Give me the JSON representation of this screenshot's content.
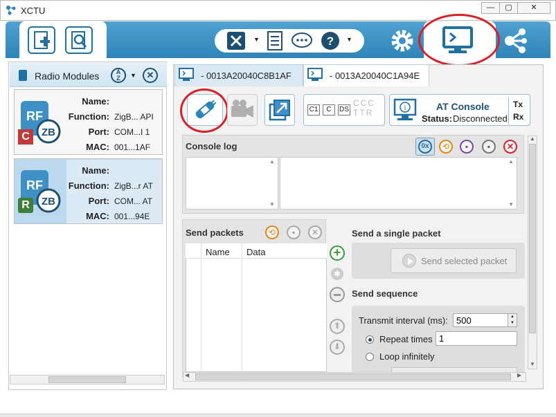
{
  "window": {
    "title": "XCTU"
  },
  "left_panel": {
    "title": "Radio Modules"
  },
  "modules": [
    {
      "badge": "C",
      "badge_color": "#c0393b",
      "name": "",
      "function": "ZigB... API",
      "port": "COM...I 1",
      "mac": "001...1AF"
    },
    {
      "badge": "R",
      "badge_color": "#3e7d3a",
      "name": "",
      "function": "ZigB...r AT",
      "port": "COM... AT",
      "mac": "001...94E"
    }
  ],
  "field_labels": {
    "name": "Name:",
    "function": "Function:",
    "port": "Port:",
    "mac": "MAC:"
  },
  "tabs": [
    {
      "label": "- 0013A20040C8B1AF"
    },
    {
      "label": "- 0013A20040C1A94E"
    }
  ],
  "console": {
    "mode": "AT Console",
    "status_label": "Status:",
    "status_value": "Disconnected",
    "tx": "Tx",
    "rx": "Rx",
    "log_title": "Console log",
    "hex_button": "0x"
  },
  "frame_buttons": [
    "C1",
    "C",
    "DS"
  ],
  "send_packets": {
    "title": "Send packets",
    "columns": [
      "Name",
      "Data"
    ]
  },
  "single_packet": {
    "title": "Send a single packet",
    "button": "Send selected packet"
  },
  "sequence": {
    "title": "Send sequence",
    "interval_label": "Transmit interval (ms):",
    "interval_value": "500",
    "repeat_label": "Repeat times",
    "repeat_value": "1",
    "loop_label": "Loop infinitely"
  },
  "colors": {
    "accent": "#2f84b8",
    "highlight": "#d81f27"
  }
}
